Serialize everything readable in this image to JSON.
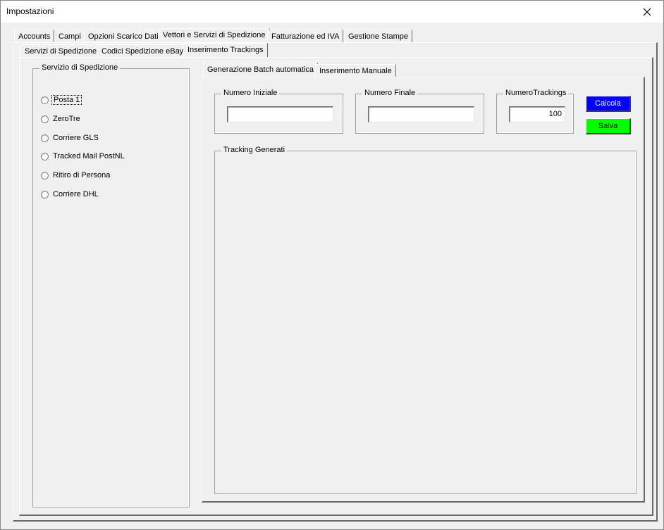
{
  "window": {
    "title": "Impostazioni"
  },
  "main_tabs": [
    {
      "label": "Accounts"
    },
    {
      "label": "Campi"
    },
    {
      "label": "Opzioni Scarico Dati"
    },
    {
      "label": "Vettori e Servizi di Spedizione"
    },
    {
      "label": "Fatturazione ed IVA"
    },
    {
      "label": "Gestione Stampe"
    }
  ],
  "sub_tabs": [
    {
      "label": "Servizi di Spedizione"
    },
    {
      "label": "Codici Spedizione eBay"
    },
    {
      "label": "Inserimento Trackings"
    }
  ],
  "service_group": {
    "caption": "Servizio di Spedizione",
    "options": [
      {
        "label": "Posta 1"
      },
      {
        "label": "ZeroTre"
      },
      {
        "label": "Corriere GLS"
      },
      {
        "label": "Tracked Mail PostNL"
      },
      {
        "label": "Ritiro di Persona"
      },
      {
        "label": "Corriere DHL"
      }
    ]
  },
  "inner_tabs": [
    {
      "label": "Generazione Batch automatica"
    },
    {
      "label": "Inserimento Manuale"
    }
  ],
  "batch": {
    "start_caption": "Numero Iniziale",
    "start_value": "",
    "end_caption": "Numero Finale",
    "end_value": "",
    "count_caption": "NumeroTrackings",
    "count_value": "100",
    "calc_label": "Calcola",
    "save_label": "Salva",
    "generated_caption": "Tracking Generati"
  },
  "colors": {
    "calc_button": "#0000ff",
    "save_button": "#00ff00"
  }
}
